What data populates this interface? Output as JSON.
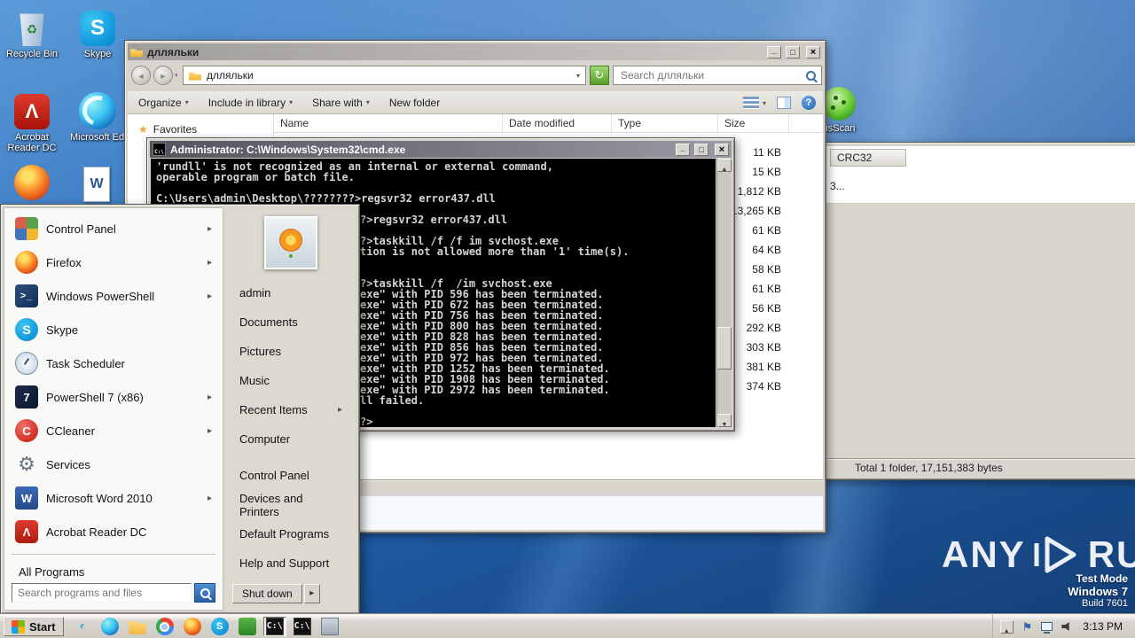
{
  "desktop": {
    "icons": [
      {
        "label": "Recycle Bin",
        "icon": "recycle-bin"
      },
      {
        "label": "Skype",
        "icon": "skype"
      },
      {
        "label": "Acrobat Reader DC",
        "icon": "acrobat-reader"
      },
      {
        "label": "Microsoft Edge",
        "icon": "edge"
      },
      {
        "label": "usScan",
        "icon": "virus-scan"
      }
    ],
    "partial_icons": [
      "flame-swirl-icon",
      "word-document-icon"
    ],
    "watermark": {
      "left": "ANY",
      "right": "RUN"
    },
    "build_info": {
      "line1": "Test Mode",
      "line2": "Windows 7",
      "line3": "Build 7601"
    }
  },
  "explorer": {
    "title": "длляльки",
    "address": "длляльки",
    "search_placeholder": "Search длляльки",
    "toolbar": [
      {
        "label": "Organize",
        "dropdown": true
      },
      {
        "label": "Include in library",
        "dropdown": true
      },
      {
        "label": "Share with",
        "dropdown": true
      },
      {
        "label": "New folder",
        "dropdown": false
      }
    ],
    "favorites": "Favorites",
    "columns": [
      {
        "label": "Name"
      },
      {
        "label": "Date modified"
      },
      {
        "label": "Type"
      },
      {
        "label": "Size"
      }
    ],
    "sizes": [
      "11 KB",
      "15 KB",
      "1,812 KB",
      "13,265 KB",
      "61 KB",
      "64 KB",
      "58 KB",
      "61 KB",
      "56 KB",
      "292 KB",
      "303 KB",
      "381 KB",
      "374 KB"
    ]
  },
  "background_window": {
    "column_header": "CRC32",
    "cell_fragment": "3...",
    "status_bar": "Total 1 folder, 17,151,383 bytes"
  },
  "cmd": {
    "title": "Administrator: C:\\Windows\\System32\\cmd.exe",
    "lines": [
      {
        "text": "'rundll' is not recognized as an internal or external command,",
        "cut": false
      },
      {
        "text": "operable program or batch file.",
        "cut": false
      },
      {
        "text": "",
        "cut": false
      },
      {
        "text": "C:\\Users\\admin\\Desktop\\????????>regsvr32 error437.dll",
        "cut": false
      },
      {
        "text": "",
        "cut": false
      },
      {
        "text": "?>regsvr32 error437.dll",
        "cut": true
      },
      {
        "text": "",
        "cut": false
      },
      {
        "text": "?>taskkill /f /f im svchost.exe",
        "cut": true
      },
      {
        "text": "tion is not allowed more than '1' time(s).",
        "cut": true
      },
      {
        "text": "",
        "cut": false
      },
      {
        "text": "",
        "cut": false
      },
      {
        "text": "?>taskkill /f  /im svchost.exe",
        "cut": true
      },
      {
        "text": "exe\" with PID 596 has been terminated.",
        "cut": true
      },
      {
        "text": "exe\" with PID 672 has been terminated.",
        "cut": true
      },
      {
        "text": "exe\" with PID 756 has been terminated.",
        "cut": true
      },
      {
        "text": "exe\" with PID 800 has been terminated.",
        "cut": true
      },
      {
        "text": "exe\" with PID 828 has been terminated.",
        "cut": true
      },
      {
        "text": "exe\" with PID 856 has been terminated.",
        "cut": true
      },
      {
        "text": "exe\" with PID 972 has been terminated.",
        "cut": true
      },
      {
        "text": "exe\" with PID 1252 has been terminated.",
        "cut": true
      },
      {
        "text": "exe\" with PID 1908 has been terminated.",
        "cut": true
      },
      {
        "text": "exe\" with PID 2972 has been terminated.",
        "cut": true
      },
      {
        "text": "ll failed.",
        "cut": true
      },
      {
        "text": "",
        "cut": false
      },
      {
        "text": "?>",
        "cut": true
      }
    ]
  },
  "start_menu": {
    "left_items": [
      {
        "label": "Control Panel",
        "icon": "control-panel",
        "jump": true
      },
      {
        "label": "Firefox",
        "icon": "firefox",
        "jump": true
      },
      {
        "label": "Windows PowerShell",
        "icon": "powershell",
        "jump": true
      },
      {
        "label": "Skype",
        "icon": "skype",
        "jump": false
      },
      {
        "label": "Task Scheduler",
        "icon": "task-scheduler",
        "jump": false
      },
      {
        "label": "PowerShell 7 (x86)",
        "icon": "powershell7",
        "jump": true
      },
      {
        "label": "CCleaner",
        "icon": "ccleaner",
        "jump": true
      },
      {
        "label": "Services",
        "icon": "services",
        "jump": false
      },
      {
        "label": "Microsoft Word 2010",
        "icon": "word",
        "jump": true
      },
      {
        "label": "Acrobat Reader DC",
        "icon": "acrobat",
        "jump": false
      }
    ],
    "all_programs": "All Programs",
    "search_placeholder": "Search programs and files",
    "right_items": [
      {
        "label": "admin",
        "arrow": false
      },
      {
        "label": "Documents",
        "arrow": false
      },
      {
        "label": "Pictures",
        "arrow": false
      },
      {
        "label": "Music",
        "arrow": false
      },
      {
        "label": "Recent Items",
        "arrow": true
      },
      {
        "label": "Computer",
        "arrow": false
      },
      {
        "label": "Control Panel",
        "arrow": false
      },
      {
        "label": "Devices and Printers",
        "arrow": false
      },
      {
        "label": "Default Programs",
        "arrow": false
      },
      {
        "label": "Help and Support",
        "arrow": false
      }
    ],
    "shutdown_label": "Shut down"
  },
  "taskbar": {
    "start_label": "Start",
    "quick_icons": [
      {
        "icon": "internet-explorer",
        "pressed": false
      },
      {
        "icon": "edge",
        "pressed": false
      },
      {
        "icon": "folder-explorer",
        "pressed": false
      },
      {
        "icon": "chrome",
        "pressed": false
      },
      {
        "icon": "firefox",
        "pressed": false
      },
      {
        "icon": "skype",
        "pressed": false
      },
      {
        "icon": "green-app",
        "pressed": false
      },
      {
        "icon": "cmd",
        "pressed": true
      },
      {
        "icon": "console",
        "pressed": false
      },
      {
        "icon": "app-window",
        "pressed": false
      }
    ],
    "tray_icons": [
      "hidden-icons-chevron",
      "action-center-flag",
      "network",
      "volume"
    ],
    "clock": "3:13 PM"
  }
}
